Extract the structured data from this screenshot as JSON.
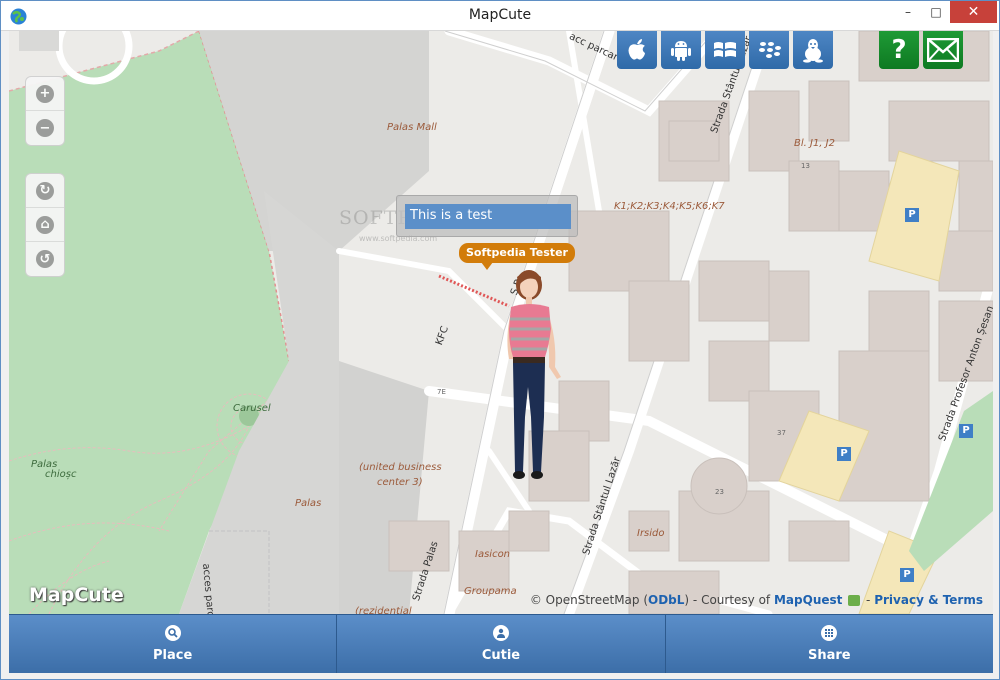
{
  "window": {
    "title": "MapCute",
    "minimize_icon": "minimize-icon",
    "maximize_icon": "maximize-icon",
    "close_icon": "close-icon"
  },
  "map": {
    "labels": {
      "palas_mall": "Palas Mall",
      "acc_parcare_top": "acc parcare",
      "strada_stantul_lazar_top": "Strada Stântul Lazăr",
      "bl_j": "Bl. J1, J2",
      "num_13": "13",
      "k_labels": "K1;K2;K3;K4;K5;K6;K7",
      "kfc": "KFC",
      "num_7e": "7E",
      "carusel": "Carusel",
      "palas_chiosc_1": "Palas",
      "palas_chiosc_2": "chioșc",
      "united_business_1": "(united business",
      "united_business_2": "center 3)",
      "palas": "Palas",
      "num_37": "37",
      "num_23": "23",
      "irsido": "Irsido",
      "iasicon": "Iasicon",
      "groupama": "Groupama",
      "rezidential": "(rezidențial",
      "strada_palas": "Strada Palas",
      "strada_stantul_lazar_bottom": "Strada Stântul Lazăr",
      "strada_profesor": "Strada Profesor Anton Șesan",
      "acces_parcare_bottom": "acces parc",
      "street_sp": "S P",
      "parking": "P"
    },
    "message_text": "This is a test",
    "avatar_name": "Softpedia Tester",
    "brand": "MapCute",
    "watermark": "SOFTPEDIA",
    "watermark_small": "www.softpedia.com",
    "attribution": {
      "prefix": "© OpenStreetMap (",
      "odbl": "ODbL",
      "middle": ") - Courtesy of",
      "mapquest": "MapQuest",
      "dash": "-",
      "privacy": "Privacy & Terms"
    }
  },
  "controls": {
    "zoom_in": "+",
    "zoom_out": "−",
    "rotate_cw": "↻",
    "home": "⌂",
    "rotate_ccw": "↺"
  },
  "platforms": [
    {
      "name": "apple-icon",
      "glyph": ""
    },
    {
      "name": "android-icon",
      "glyph": ""
    },
    {
      "name": "windows-icon",
      "glyph": ""
    },
    {
      "name": "blackberry-icon",
      "glyph": ""
    },
    {
      "name": "linux-icon",
      "glyph": ""
    }
  ],
  "help_label": "?",
  "bottom_tabs": [
    {
      "label": "Place",
      "icon": "search-icon"
    },
    {
      "label": "Cutie",
      "icon": "user-icon"
    },
    {
      "label": "Share",
      "icon": "grid-icon"
    }
  ],
  "colors": {
    "accent_blue": "#3c6ea8",
    "help_green": "#1f9a36",
    "name_tag": "#d27c0a",
    "message_bg": "#5b8fc9",
    "close_red": "#c7413a"
  }
}
